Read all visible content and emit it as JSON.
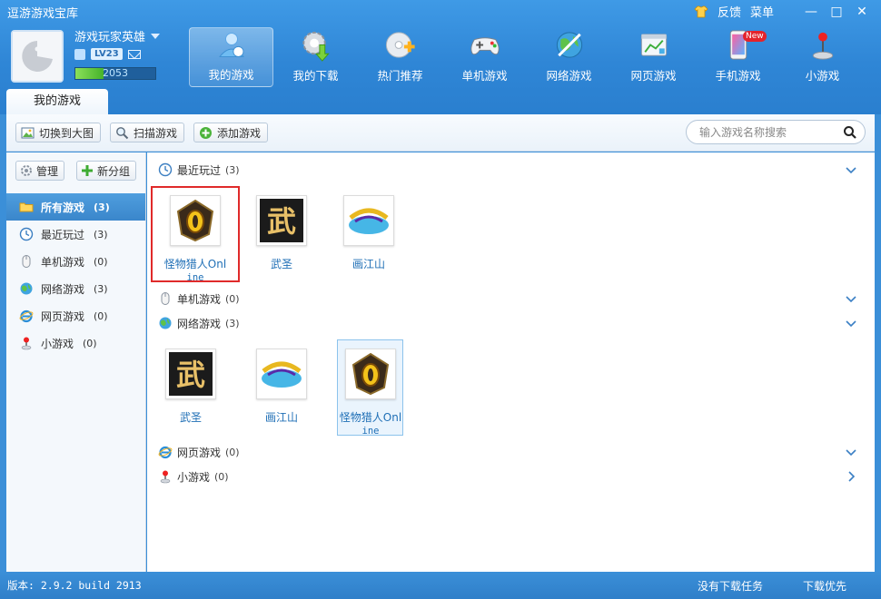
{
  "app": {
    "title": "逗游游戏宝库",
    "feedback": "反馈",
    "menu": "菜单",
    "minimize": "—",
    "maximize": "□",
    "close": "✕"
  },
  "user": {
    "name": "游戏玩家英雄",
    "level": "LV23",
    "exp": "2053",
    "exp_fraction": 0.35
  },
  "nav": [
    {
      "label": "我的游戏",
      "icon": "my-games-icon"
    },
    {
      "label": "我的下载",
      "icon": "download-gear-icon"
    },
    {
      "label": "热门推荐",
      "icon": "hot-disc-icon"
    },
    {
      "label": "单机游戏",
      "icon": "gamepad-icon"
    },
    {
      "label": "网络游戏",
      "icon": "globe-icon"
    },
    {
      "label": "网页游戏",
      "icon": "web-chart-icon"
    },
    {
      "label": "手机游戏",
      "icon": "phone-icon",
      "badge": "New"
    },
    {
      "label": "小游戏",
      "icon": "joystick-icon"
    }
  ],
  "tab": "我的游戏",
  "toolbar": {
    "switch_view": "切换到大图",
    "scan": "扫描游戏",
    "add": "添加游戏",
    "search_placeholder": "输入游戏名称搜索"
  },
  "left": {
    "manage": "管理",
    "new_group": "新分组",
    "items": [
      {
        "label": "所有游戏",
        "count": "(3)"
      },
      {
        "label": "最近玩过",
        "count": "(3)"
      },
      {
        "label": "单机游戏",
        "count": "(0)"
      },
      {
        "label": "网络游戏",
        "count": "(3)"
      },
      {
        "label": "网页游戏",
        "count": "(0)"
      },
      {
        "label": "小游戏",
        "count": "(0)"
      }
    ]
  },
  "sections": {
    "recent": {
      "label": "最近玩过",
      "count": "(3)"
    },
    "single": {
      "label": "单机游戏",
      "count": "(0)"
    },
    "online": {
      "label": "网络游戏",
      "count": "(3)"
    },
    "web": {
      "label": "网页游戏",
      "count": "(0)"
    },
    "mini": {
      "label": "小游戏",
      "count": "(0)"
    }
  },
  "games": {
    "monster_a": "怪物猎人Onl",
    "monster_b": "ine",
    "wusheng": "武圣",
    "huajiangshan": "画江山"
  },
  "status": {
    "version": "版本: 2.9.2 build 2913",
    "no_tasks": "没有下载任务",
    "priority": "下载优先"
  }
}
